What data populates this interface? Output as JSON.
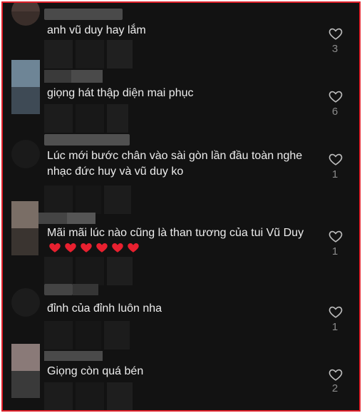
{
  "colors": {
    "background": "#121212",
    "text": "#ededed",
    "muted": "#8a8a8a",
    "border": "#e0202a",
    "heart": "#e8202f"
  },
  "comments": [
    {
      "text": "anh vũ duy hay lắm",
      "likes": "3"
    },
    {
      "text": "giọng hát thập diện mai phục",
      "likes": "6"
    },
    {
      "text": "Lúc mới bước chân vào sài gòn lần đầu toàn nghe nhạc đức huy và vũ duy ko",
      "likes": "1"
    },
    {
      "text": "Mãi mãi lúc nào cũng là than tương của tui Vũ Duy",
      "likes": "1",
      "emoji": "❤️❤️❤️❤️❤️❤️"
    },
    {
      "text": "đỉnh của đỉnh luôn nha",
      "likes": "1"
    },
    {
      "text": "Giọng còn quá bén",
      "likes": "2"
    }
  ],
  "icons": {
    "like": "heart-outline-icon",
    "emoji": "red-heart-emoji"
  }
}
